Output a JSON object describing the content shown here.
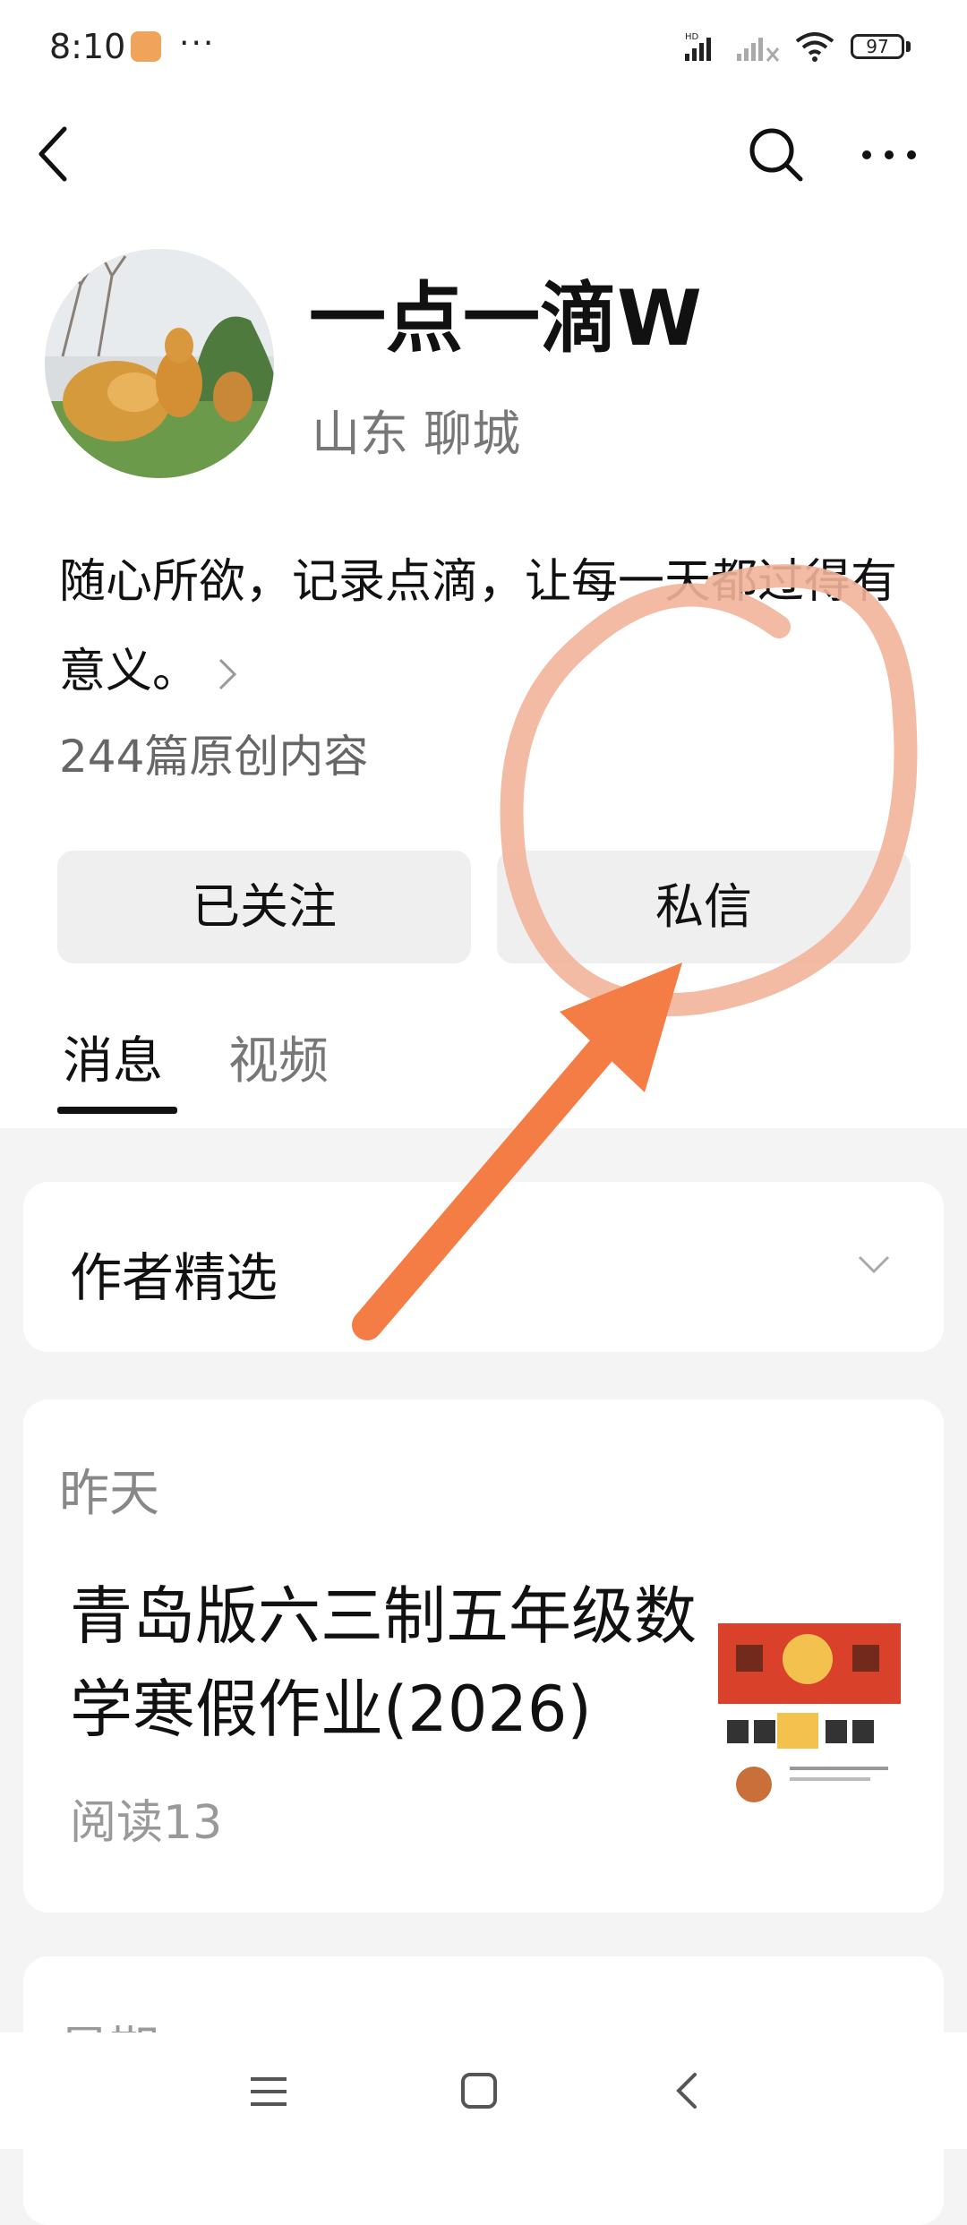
{
  "status_bar": {
    "time": "8:10",
    "battery": "97"
  },
  "nav": {
    "back_icon": "chevron-left-icon",
    "search_icon": "search-icon",
    "more_icon": "more-horizontal-icon"
  },
  "profile": {
    "name": "一点一滴W",
    "location": "山东 聊城",
    "bio": "随心所欲，记录点滴，让每一天都过得有意义。",
    "stats": "244篇原创内容"
  },
  "actions": {
    "follow_label": "已关注",
    "message_label": "私信"
  },
  "tabs": [
    {
      "label": "消息",
      "active": true
    },
    {
      "label": "视频",
      "active": false
    }
  ],
  "featured": {
    "title": "作者精选"
  },
  "posts": [
    {
      "date": "昨天",
      "title": "青岛版六三制五年级数学寒假作业(2026)",
      "reads": "阅读13"
    }
  ],
  "next_card": {
    "date": "星期"
  },
  "colors": {
    "annotation_arrow": "#f47c45",
    "annotation_circle": "#f2b49a",
    "button_bg": "#efefef",
    "page_bg": "#f4f4f4"
  }
}
